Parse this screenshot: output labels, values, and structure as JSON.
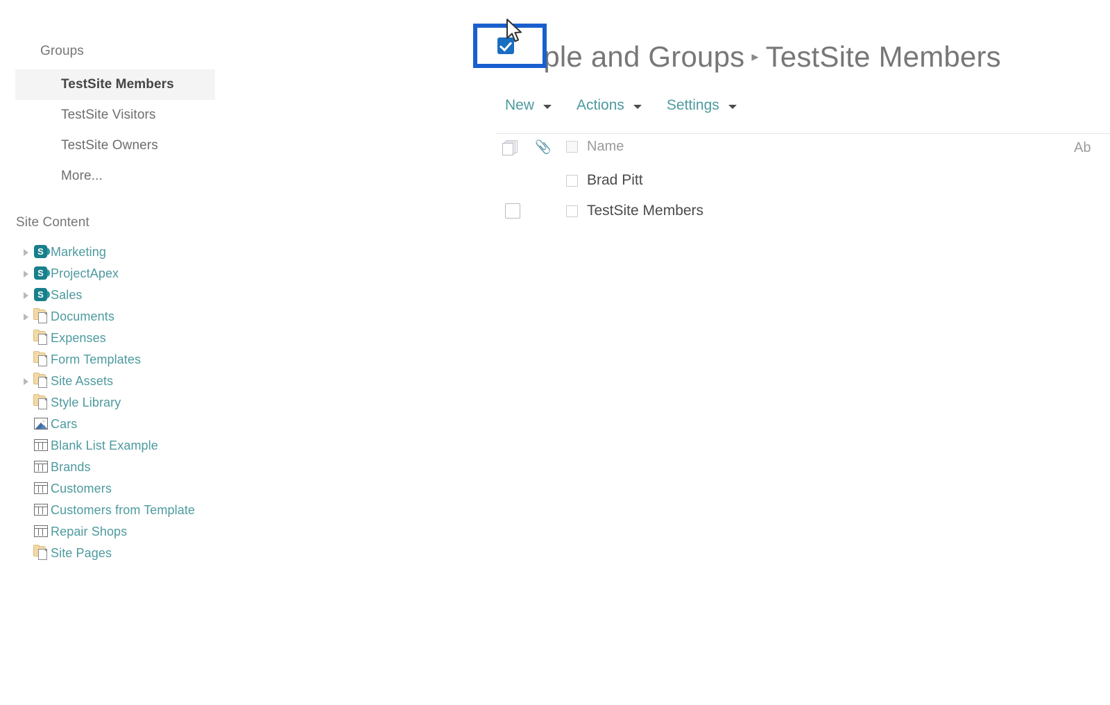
{
  "sidebar": {
    "groups_heading": "Groups",
    "groups": [
      {
        "label": "TestSite Members",
        "selected": true
      },
      {
        "label": "TestSite Visitors",
        "selected": false
      },
      {
        "label": "TestSite Owners",
        "selected": false
      },
      {
        "label": "More...",
        "selected": false
      }
    ],
    "site_content_heading": "Site Content",
    "tree": [
      {
        "label": "Marketing",
        "icon": "sharepoint-site-icon",
        "expandable": true
      },
      {
        "label": "ProjectApex",
        "icon": "sharepoint-site-icon",
        "expandable": true
      },
      {
        "label": "Sales",
        "icon": "sharepoint-site-icon",
        "expandable": true
      },
      {
        "label": "Documents",
        "icon": "document-library-icon",
        "expandable": true
      },
      {
        "label": "Expenses",
        "icon": "document-library-icon",
        "expandable": false
      },
      {
        "label": "Form Templates",
        "icon": "document-library-icon",
        "expandable": false
      },
      {
        "label": "Site Assets",
        "icon": "document-library-icon",
        "expandable": true
      },
      {
        "label": "Style Library",
        "icon": "document-library-icon",
        "expandable": false
      },
      {
        "label": "Cars",
        "icon": "picture-library-icon",
        "expandable": false
      },
      {
        "label": "Blank List Example",
        "icon": "list-icon",
        "expandable": false
      },
      {
        "label": "Brands",
        "icon": "list-icon",
        "expandable": false
      },
      {
        "label": "Customers",
        "icon": "list-icon",
        "expandable": false
      },
      {
        "label": "Customers from Template",
        "icon": "list-icon",
        "expandable": false
      },
      {
        "label": "Repair Shops",
        "icon": "list-icon",
        "expandable": false
      },
      {
        "label": "Site Pages",
        "icon": "document-library-icon",
        "expandable": false
      }
    ]
  },
  "main": {
    "breadcrumb": {
      "root": "People and Groups",
      "separator": "▸",
      "current": "TestSite Members"
    },
    "toolbar": [
      {
        "label": "New"
      },
      {
        "label": "Actions"
      },
      {
        "label": "Settings"
      }
    ],
    "table": {
      "headers": {
        "select_all_icon": "stacked-documents-icon",
        "attachment_icon": "📎",
        "name": "Name",
        "second_column": "Ab"
      },
      "rows": [
        {
          "name": "Brad Pitt",
          "row_selected": true
        },
        {
          "name": "TestSite Members",
          "row_selected": false
        }
      ]
    }
  },
  "colors": {
    "link_teal": "#4d9a9e",
    "highlight_blue": "#1a5fce",
    "checkbox_blue": "#1a6ec2",
    "selected_row_bg": "#f4f4f4",
    "sharepoint_teal": "#18808b"
  }
}
